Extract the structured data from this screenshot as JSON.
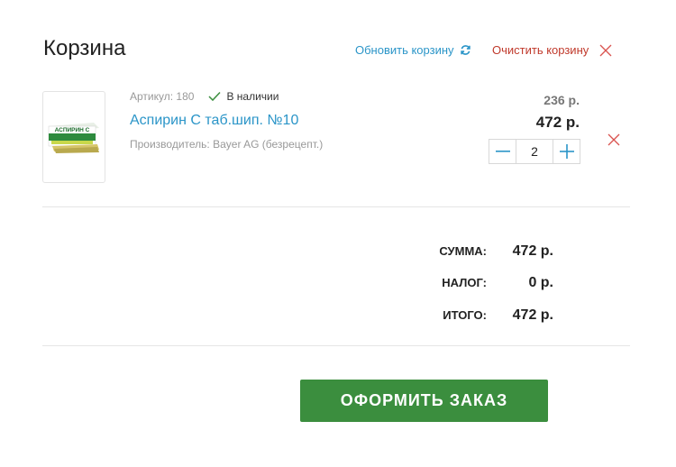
{
  "page": {
    "title": "Корзина"
  },
  "header": {
    "refresh_label": "Обновить корзину",
    "clear_label": "Очистить корзину"
  },
  "colors": {
    "link": "#2b95c8",
    "danger": "#c0392b",
    "success": "#3b8e3e",
    "button": "#3b8e3e"
  },
  "item": {
    "article": "Артикул: 180",
    "stock": "В наличии",
    "name": "Аспирин С таб.шип. №10",
    "manufacturer": "Производитель: Bayer AG (безрецепт.)",
    "unit_price": "236 р.",
    "line_total": "472 р.",
    "quantity": "2",
    "image_brand": "АСПИРИН С"
  },
  "summary": {
    "sum_label": "СУММА:",
    "sum_value": "472 р.",
    "tax_label": "НАЛОГ:",
    "tax_value": "0 р.",
    "total_label": "ИТОГО:",
    "total_value": "472 р."
  },
  "checkout": {
    "label": "ОФОРМИТЬ ЗАКАЗ"
  }
}
